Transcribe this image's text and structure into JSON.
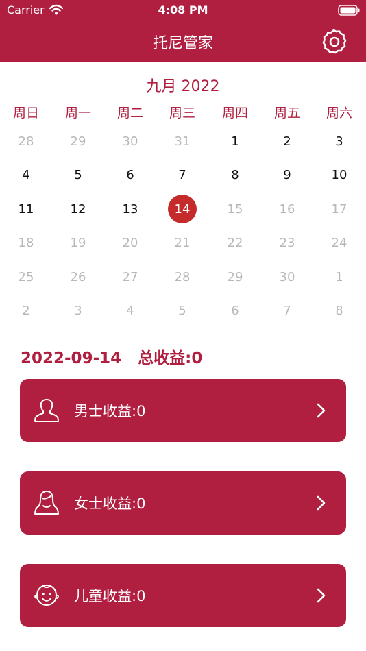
{
  "status_bar": {
    "carrier": "Carrier",
    "time": "4:08 PM"
  },
  "header": {
    "title": "托尼管家",
    "settings_icon": "gear-icon"
  },
  "calendar": {
    "month_title": "九月 2022",
    "weekdays": [
      "周日",
      "周一",
      "周二",
      "周三",
      "周四",
      "周五",
      "周六"
    ],
    "days": [
      {
        "d": "28",
        "muted": true
      },
      {
        "d": "29",
        "muted": true
      },
      {
        "d": "30",
        "muted": true
      },
      {
        "d": "31",
        "muted": true
      },
      {
        "d": "1",
        "muted": false
      },
      {
        "d": "2",
        "muted": false
      },
      {
        "d": "3",
        "muted": false
      },
      {
        "d": "4",
        "muted": false
      },
      {
        "d": "5",
        "muted": false
      },
      {
        "d": "6",
        "muted": false
      },
      {
        "d": "7",
        "muted": false
      },
      {
        "d": "8",
        "muted": false
      },
      {
        "d": "9",
        "muted": false
      },
      {
        "d": "10",
        "muted": false
      },
      {
        "d": "11",
        "muted": false
      },
      {
        "d": "12",
        "muted": false
      },
      {
        "d": "13",
        "muted": false
      },
      {
        "d": "14",
        "muted": false,
        "selected": true
      },
      {
        "d": "15",
        "muted": true
      },
      {
        "d": "16",
        "muted": true
      },
      {
        "d": "17",
        "muted": true
      },
      {
        "d": "18",
        "muted": true
      },
      {
        "d": "19",
        "muted": true
      },
      {
        "d": "20",
        "muted": true
      },
      {
        "d": "21",
        "muted": true
      },
      {
        "d": "22",
        "muted": true
      },
      {
        "d": "23",
        "muted": true
      },
      {
        "d": "24",
        "muted": true
      },
      {
        "d": "25",
        "muted": true
      },
      {
        "d": "26",
        "muted": true
      },
      {
        "d": "27",
        "muted": true
      },
      {
        "d": "28",
        "muted": true
      },
      {
        "d": "29",
        "muted": true
      },
      {
        "d": "30",
        "muted": true
      },
      {
        "d": "1",
        "muted": true
      },
      {
        "d": "2",
        "muted": true
      },
      {
        "d": "3",
        "muted": true
      },
      {
        "d": "4",
        "muted": true
      },
      {
        "d": "5",
        "muted": true
      },
      {
        "d": "6",
        "muted": true
      },
      {
        "d": "7",
        "muted": true
      },
      {
        "d": "8",
        "muted": true
      }
    ]
  },
  "summary": {
    "date": "2022-09-14",
    "total": "总收益:0"
  },
  "cards": [
    {
      "label": "男士收益:0",
      "icon": "man-icon"
    },
    {
      "label": "女士收益:0",
      "icon": "woman-icon"
    },
    {
      "label": "儿童收益:0",
      "icon": "child-icon"
    }
  ],
  "colors": {
    "brand": "#b01e40",
    "selected": "#c62b2b",
    "muted_text": "#b8b8b8"
  }
}
